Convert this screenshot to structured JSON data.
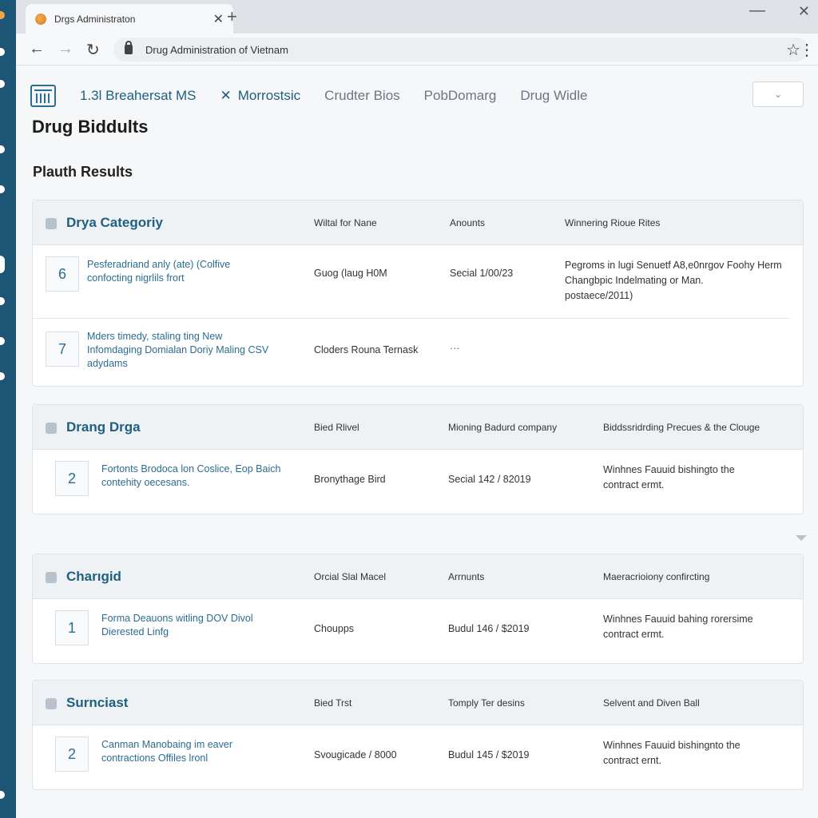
{
  "browser": {
    "tab_title": "Drgs Administraton",
    "tab_close": "✕",
    "new_tab": "+",
    "url": "Drug Administration of Vietnam",
    "back": "←",
    "forward": "→",
    "reload": "↻",
    "star": "☆",
    "menu": "⋮",
    "minimize": "—",
    "close": "✕"
  },
  "site_nav": {
    "items": [
      "1.3l Breahersat MS",
      "Morrostsic",
      "Crudter Bios",
      "PobDomarg",
      "Drug Widle"
    ],
    "dropdown": "⌄"
  },
  "page": {
    "title": "Drug Biddults",
    "subtitle": "Plauth Results"
  },
  "sections": [
    {
      "name": "Drya Categoriy",
      "columns": [
        "Wiltal for Nane",
        "Anounts",
        "Winnering Rioue Rites"
      ],
      "rows": [
        {
          "num": "6",
          "desc": [
            "Pesferadriand anly (ate) (Colfive",
            "confocting nigrlils frort"
          ],
          "c1": "Guog (laug H0M",
          "c2": "Secial 1/00/23",
          "c3": [
            "Pegroms in lugi Senuetf A8,e0nrgov Foohy Herm",
            "Changbpic Indelmating or Man.",
            "postaece/2011)"
          ]
        },
        {
          "num": "7",
          "desc": [
            "Mders timedy, staling ting New",
            "Infomdaging Domialan Doriy Maling CSV",
            "adydams"
          ],
          "c1": "Cloders Rouna Ternask",
          "c2": "···",
          "c3": []
        }
      ]
    },
    {
      "name": "Drang Drga",
      "columns": [
        "Bied Rlivel",
        "Mioning Badurd company",
        "Biddssridrding Precues & the Clouge"
      ],
      "rows": [
        {
          "num": "2",
          "desc": [
            "Fortonts Brodoca lon Coslice, Eop Baich",
            "contehity oecesans."
          ],
          "c1": "Bronythage Bird",
          "c2": "Secial 142 / 82019",
          "c3": [
            "Winhnes Fauuid bishingto the",
            "contract ermt."
          ]
        }
      ]
    },
    {
      "name": "Charıgid",
      "columns": [
        "Orcial Slal Macel",
        "Arrnunts",
        "Maeracrioiony confircting"
      ],
      "rows": [
        {
          "num": "1",
          "desc": [
            "Forma Deauons witling DOV Divol",
            "Dierested Linfg"
          ],
          "c1": "Choupps",
          "c2": "Budul 146 / $2019",
          "c3": [
            "Winhnes Fauuid bahing rorersime",
            "contract ermt."
          ]
        }
      ]
    },
    {
      "name": "Surnciast",
      "columns": [
        "Bied Trst",
        "Tomply Ter desins",
        "Selvent and Diven Ball"
      ],
      "rows": [
        {
          "num": "2",
          "desc": [
            "Canman Manobaing im eaver",
            "contractions Offiles lronl"
          ],
          "c1": "Svougicade / 8000",
          "c2": "Budul 145 / $2019",
          "c3": [
            "Winhnes Fauuid bishingnto the",
            "contract ernt."
          ]
        }
      ]
    }
  ]
}
